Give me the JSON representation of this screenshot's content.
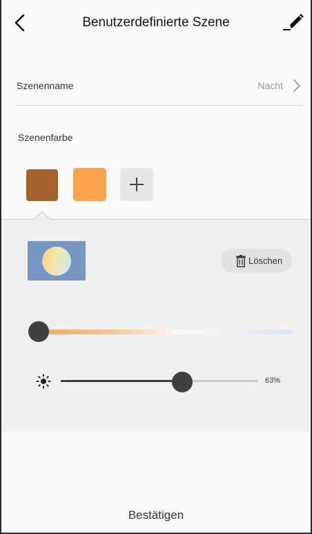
{
  "header": {
    "title": "Benutzerdefinierte Szene"
  },
  "scene_name": {
    "label": "Szenenname",
    "value": "Nacht"
  },
  "scene_color": {
    "label": "Szenenfarbe",
    "swatches": [
      "#a3622b",
      "#fca34c"
    ]
  },
  "editor": {
    "delete_label": "Löschen",
    "brightness_value": "63%",
    "brightness_percent": 63
  },
  "footer": {
    "confirm_label": "Bestätigen"
  },
  "colors": {
    "panel": "#f0f0f0",
    "preview_bg": "#7696c4",
    "thumb": "#404040"
  }
}
